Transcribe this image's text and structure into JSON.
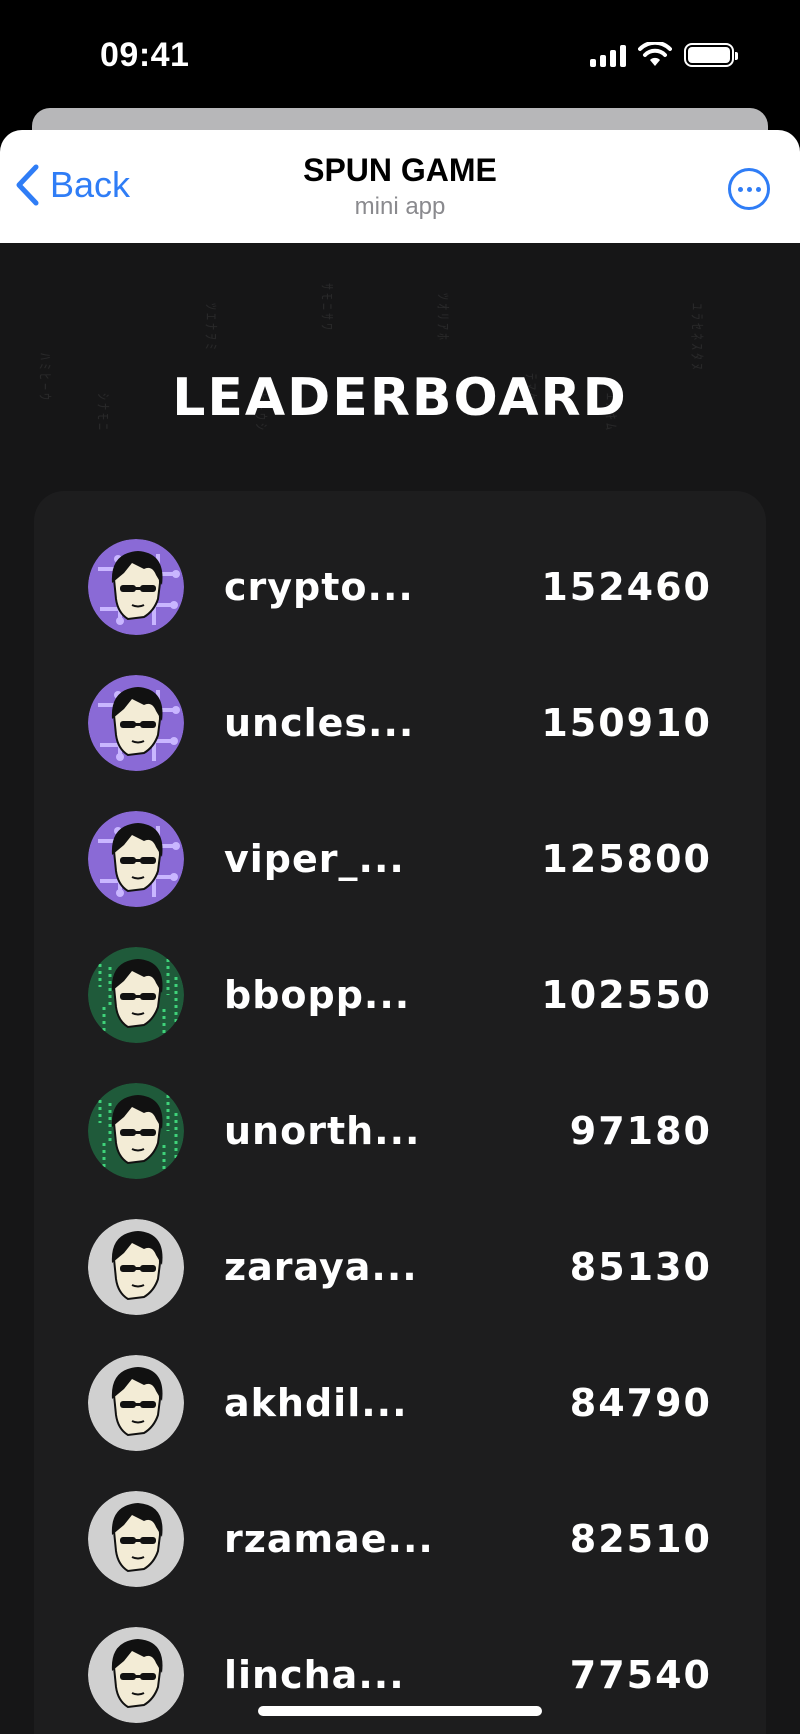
{
  "status_bar": {
    "time": "09:41"
  },
  "header": {
    "back_label": "Back",
    "title": "SPUN GAME",
    "subtitle": "mini app"
  },
  "page": {
    "title": "LEADERBOARD"
  },
  "leaderboard": [
    {
      "name": "crypto...",
      "score": "152460",
      "avatar": "purple"
    },
    {
      "name": "uncles...",
      "score": "150910",
      "avatar": "purple"
    },
    {
      "name": "viper_...",
      "score": "125800",
      "avatar": "purple"
    },
    {
      "name": "bbopp...",
      "score": "102550",
      "avatar": "green"
    },
    {
      "name": "unorth...",
      "score": "97180",
      "avatar": "green"
    },
    {
      "name": "zaraya...",
      "score": "85130",
      "avatar": "gray"
    },
    {
      "name": "akhdil...",
      "score": "84790",
      "avatar": "gray"
    },
    {
      "name": "rzamae...",
      "score": "82510",
      "avatar": "gray"
    },
    {
      "name": "lincha...",
      "score": "77540",
      "avatar": "gray"
    }
  ],
  "colors": {
    "accent": "#2f7df6",
    "background": "#161617",
    "panel": "#1d1d1e",
    "avatar_purple": "#8a6ad6",
    "avatar_green": "#1f5a3a",
    "avatar_gray": "#d0d0d0"
  }
}
